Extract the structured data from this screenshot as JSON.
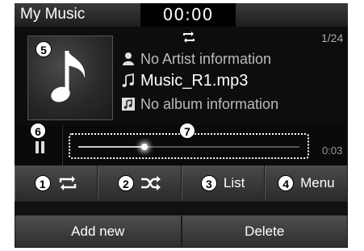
{
  "header": {
    "title": "My Music",
    "clock": "00:00"
  },
  "now_playing": {
    "track_count": "1/24",
    "artist": "No Artist information",
    "file": "Music_R1.mp3",
    "album": "No album information",
    "elapsed": "0:03",
    "progress_fraction": 0.3
  },
  "callouts": {
    "album_art": "5",
    "pause": "6",
    "seek": "7",
    "repeat": "1",
    "shuffle": "2",
    "list": "3",
    "menu": "4"
  },
  "controls": {
    "list_label": "List",
    "menu_label": "Menu"
  },
  "bottom": {
    "add_new_label": "Add new",
    "delete_label": "Delete"
  }
}
